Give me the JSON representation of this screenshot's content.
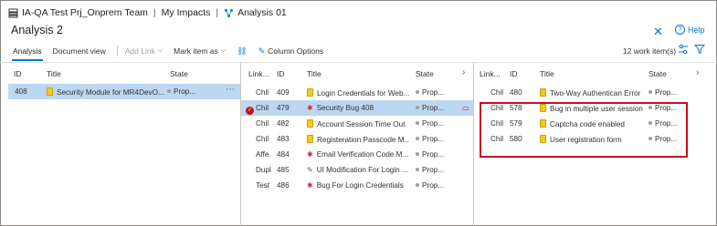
{
  "breadcrumb": {
    "project": "IA-QA Test Prj_Onprem Team",
    "queries": "My Impacts",
    "current": "Analysis 01"
  },
  "page": {
    "title": "Analysis 2"
  },
  "header_actions": {
    "close": "✕",
    "help": "Help"
  },
  "toolbar": {
    "analysis": "Analysis",
    "document_view": "Document view",
    "add_link": "Add Link",
    "mark_item_as": "Mark item as",
    "column_options": "Column Options",
    "work_items_count": "12 work item(s)"
  },
  "panel1": {
    "headers": {
      "id": "ID",
      "title": "Title",
      "state": "State"
    },
    "rows": [
      {
        "id": "408",
        "title": "Security Module for MR4DevO...",
        "state": "Prop...",
        "icon": "story"
      }
    ]
  },
  "panel2": {
    "headers": {
      "link": "Link...",
      "id": "ID",
      "title": "Title",
      "state": "State"
    },
    "rows": [
      {
        "link": "Chil",
        "id": "409",
        "title": "Login Credentials for Web...",
        "state": "Prop...",
        "icon": "story"
      },
      {
        "link": "Chil",
        "id": "479",
        "title": "Security Bug 408",
        "state": "Prop...",
        "icon": "bug"
      },
      {
        "link": "Chil",
        "id": "482",
        "title": "Account Session Time Out",
        "state": "Prop...",
        "icon": "story"
      },
      {
        "link": "Chil",
        "id": "483",
        "title": "Registeration Passcode M...",
        "state": "Prop...",
        "icon": "story"
      },
      {
        "link": "Affe",
        "id": "484",
        "title": "Email Verification Code M...",
        "state": "Prop...",
        "icon": "bug"
      },
      {
        "link": "Dupl",
        "id": "485",
        "title": "UI Modification For Login ...",
        "state": "Prop...",
        "icon": "feature"
      },
      {
        "link": "Test",
        "id": "486",
        "title": "Bug For Login Credentials",
        "state": "Prop...",
        "icon": "task"
      }
    ]
  },
  "panel3": {
    "headers": {
      "link": "Link...",
      "id": "ID",
      "title": "Title",
      "state": "State"
    },
    "rows": [
      {
        "link": "Chil",
        "id": "480",
        "title": "Two-Way Authentican Error",
        "state": "Prop...",
        "icon": "story"
      },
      {
        "link": "Chil",
        "id": "578",
        "title": "Bug in multiple user session",
        "state": "Prop...",
        "icon": "story"
      },
      {
        "link": "Chil",
        "id": "579",
        "title": "Captcha code enabled",
        "state": "Prop...",
        "icon": "story"
      },
      {
        "link": "Chil",
        "id": "580",
        "title": "User registration form",
        "state": "Prop...",
        "icon": "story"
      }
    ]
  },
  "colors": {
    "accent": "#0078d4",
    "selected_row": "#bcd8f1",
    "highlight": "#c50f1f",
    "story_icon": "#f2cb1d",
    "bug_icon": "#cc293d"
  }
}
